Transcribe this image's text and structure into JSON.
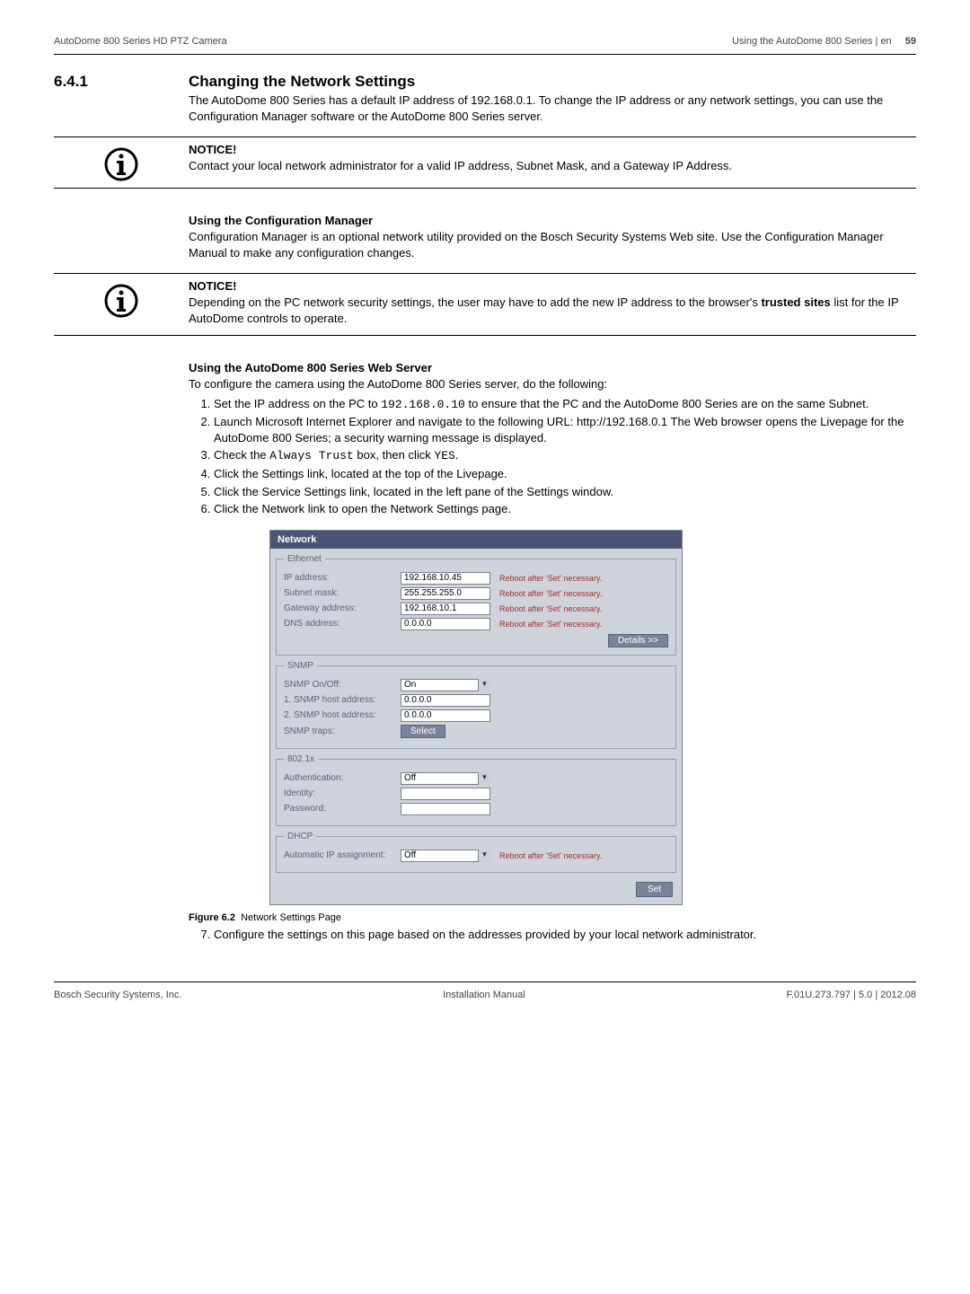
{
  "header": {
    "left": "AutoDome 800 Series HD PTZ Camera",
    "right": "Using the AutoDome 800 Series | en",
    "page": "59"
  },
  "section": {
    "number": "6.4.1",
    "title": "Changing the Network Settings",
    "intro": "The AutoDome 800 Series has a default IP address of 192.168.0.1. To change the IP address or any network settings, you can use the Configuration Manager software or the AutoDome 800 Series server."
  },
  "notice1": {
    "title": "NOTICE!",
    "text": "Contact your local network administrator for a valid IP address, Subnet Mask, and a Gateway IP Address."
  },
  "configmgr": {
    "heading": "Using the Configuration Manager",
    "text": "Configuration Manager is an optional network utility provided on the Bosch Security Systems Web site. Use the Configuration Manager Manual to make any configuration changes."
  },
  "notice2": {
    "title": "NOTICE!",
    "text_a": "Depending on the PC network security settings, the user may have to add the new IP address to the browser's ",
    "text_bold": "trusted sites",
    "text_b": " list for the IP AutoDome controls to operate."
  },
  "webserver": {
    "heading": "Using the AutoDome 800 Series Web Server",
    "intro": "To configure the camera using the AutoDome 800 Series server, do the following:",
    "steps": {
      "s1_a": "Set the IP address on the PC to ",
      "s1_ip": "192.168.0.10",
      "s1_b": " to ensure that the PC and the AutoDome 800 Series are on the same Subnet.",
      "s2": "Launch Microsoft Internet Explorer and navigate to the following URL: http://192.168.0.1 The Web browser opens the Livepage for the AutoDome 800 Series; a security warning message is displayed.",
      "s3_a": "Check the ",
      "s3_code1": "Always Trust",
      "s3_b": " box, then click ",
      "s3_code2": "YES",
      "s3_c": ".",
      "s4": "Click the Settings link, located at the top of the Livepage.",
      "s5": "Click the Service Settings link, located in the left pane of the Settings window.",
      "s6": "Click the Network link to open the Network Settings page."
    }
  },
  "network_panel": {
    "title": "Network",
    "ethernet": {
      "legend": "Ethernet",
      "ip_label": "IP address:",
      "ip_value": "192.168.10.45",
      "subnet_label": "Subnet mask:",
      "subnet_value": "255.255.255.0",
      "gateway_label": "Gateway address:",
      "gateway_value": "192.168.10.1",
      "dns_label": "DNS address:",
      "dns_value": "0.0.0.0",
      "reboot": "Reboot after 'Set' necessary.",
      "details_btn": "Details >>"
    },
    "snmp": {
      "legend": "SNMP",
      "onoff_label": "SNMP On/Off:",
      "onoff_value": "On",
      "host1_label": "1. SNMP host address:",
      "host1_value": "0.0.0.0",
      "host2_label": "2. SNMP host address:",
      "host2_value": "0.0.0.0",
      "traps_label": "SNMP traps:",
      "select_btn": "Select"
    },
    "dot1x": {
      "legend": "802.1x",
      "auth_label": "Authentication:",
      "auth_value": "Off",
      "identity_label": "Identity:",
      "identity_value": "",
      "password_label": "Password:",
      "password_value": ""
    },
    "dhcp": {
      "legend": "DHCP",
      "auto_label": "Automatic IP assignment:",
      "auto_value": "Off",
      "reboot": "Reboot after 'Set' necessary."
    },
    "set_btn": "Set"
  },
  "figure": {
    "label": "Figure 6.2",
    "caption": "Network Settings Page"
  },
  "step7": "Configure the settings on this page based on the addresses provided by your local network administrator.",
  "footer": {
    "left": "Bosch Security Systems, Inc.",
    "center": "Installation Manual",
    "right": "F.01U.273.797 | 5.0 | 2012.08"
  }
}
